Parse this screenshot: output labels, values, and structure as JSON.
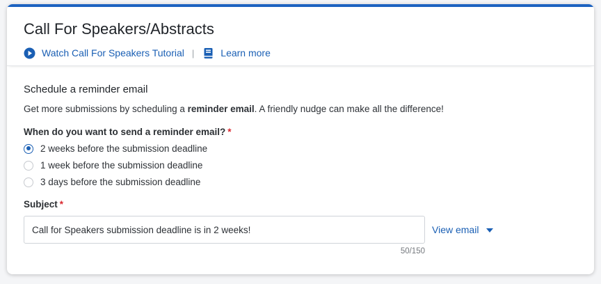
{
  "header": {
    "title": "Call For Speakers/Abstracts",
    "tutorial_link": "Watch Call For Speakers Tutorial",
    "separator": "|",
    "learn_more_link": "Learn more"
  },
  "section": {
    "title": "Schedule a reminder email",
    "description_before": "Get more submissions by scheduling a ",
    "description_bold": "reminder email",
    "description_after": ". A friendly nudge can make all the difference!"
  },
  "reminder": {
    "question": "When do you want to send a reminder email?",
    "required_mark": "*",
    "options": [
      {
        "label": "2 weeks before the submission deadline",
        "selected": true
      },
      {
        "label": "1 week before the submission deadline",
        "selected": false
      },
      {
        "label": "3 days before the submission deadline",
        "selected": false
      }
    ]
  },
  "subject": {
    "label": "Subject",
    "required_mark": "*",
    "value": "Call for Speakers submission deadline is in 2 weeks!",
    "counter": "50/150"
  },
  "view_email": {
    "label": "View email"
  },
  "colors": {
    "accent": "#1d63c1",
    "link": "#1a5fb4",
    "required": "#d9272e"
  },
  "icons": {
    "tutorial": "play-circle-icon",
    "learn_more": "book-icon",
    "view_email": "caret-down-icon"
  }
}
